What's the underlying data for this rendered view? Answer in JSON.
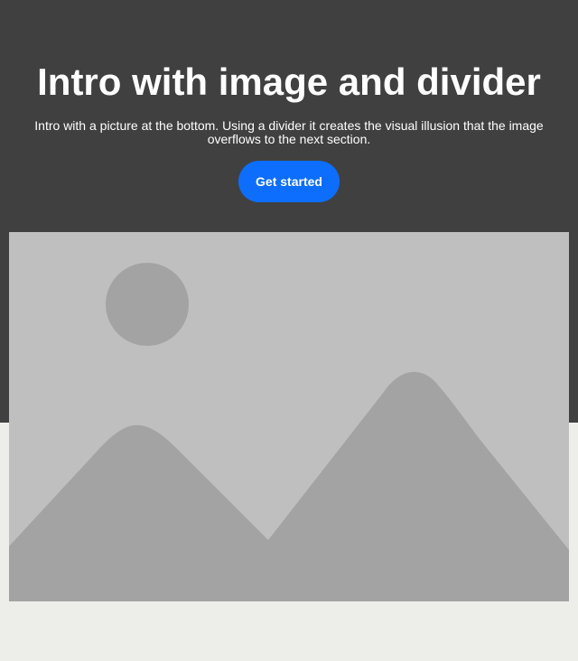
{
  "hero": {
    "title": "Intro with image and divider",
    "subtitle": "Intro with a picture at the bottom. Using a divider it creates the visual illusion that the image overflows to the next section.",
    "cta_label": "Get started"
  },
  "colors": {
    "hero_background": "#404040",
    "page_background": "#edeeea",
    "button": "#0d6efd",
    "placeholder_sky": "#bfbfbf",
    "placeholder_shapes": "#a3a3a3"
  },
  "image": {
    "icon": "image-placeholder-icon"
  }
}
